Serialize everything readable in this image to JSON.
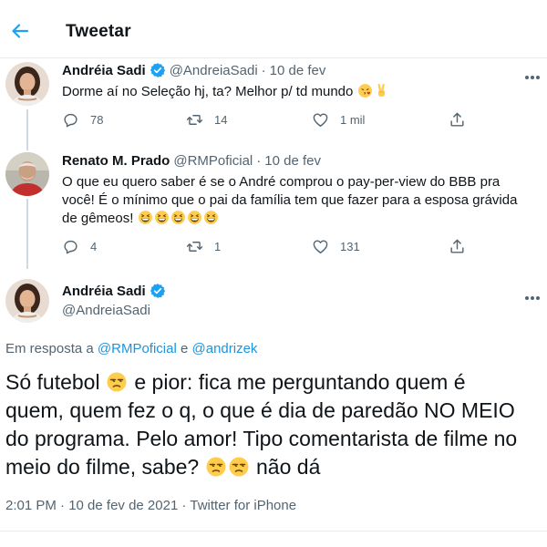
{
  "header": {
    "title": "Tweetar",
    "back_icon": "arrow-left-icon",
    "accent": "#1da1f2"
  },
  "tweets": [
    {
      "name": "Andréia Sadi",
      "handle": "@AndreiaSadi",
      "date": "10 de fev",
      "verified": true,
      "text": "Dorme aí no Seleção hj, ta? Melhor p/ td mundo",
      "emojis": [
        "kissing-face-emoji",
        "victory-hand-emoji"
      ],
      "replies": "78",
      "retweets": "14",
      "likes": "1 mil"
    },
    {
      "name": "Renato M. Prado",
      "handle": "@RMPoficial",
      "date": "10 de fev",
      "verified": false,
      "text_line1": "O que eu quero saber é se o André comprou o pay-per-view do BBB pra",
      "text_line2": "você! É o mínimo que o pai da família tem que fazer para a esposa grávida",
      "text_line3": "de gêmeos!",
      "emojis": [
        "grinning-squinting-face-emoji"
      ],
      "replies": "4",
      "retweets": "1",
      "likes": "131"
    }
  ],
  "main_tweet": {
    "name": "Andréia Sadi",
    "handle": "@AndreiaSadi",
    "verified": true,
    "reply_prefix": "Em resposta a",
    "reply_user1": "@RMPoficial",
    "reply_and": "e",
    "reply_user2": "@andrizek",
    "line1a": "Só futebol",
    "line1b": "e pior: fica me perguntando quem é",
    "line2": "quem, quem fez o q, o que é dia de paredão NO MEIO",
    "line3": "do programa. Pelo amor! Tipo comentarista de filme no",
    "line4a": "meio do filme, sabe?",
    "line4b": "não dá",
    "emojis": [
      "unamused-face-emoji"
    ],
    "timestamp": "2:01 PM · 10 de fev de 2021 · Twitter for iPhone"
  },
  "colors": {
    "verified": "#1da1f2",
    "link": "#1b95e0",
    "muted": "#536471",
    "text": "#0f1419"
  }
}
